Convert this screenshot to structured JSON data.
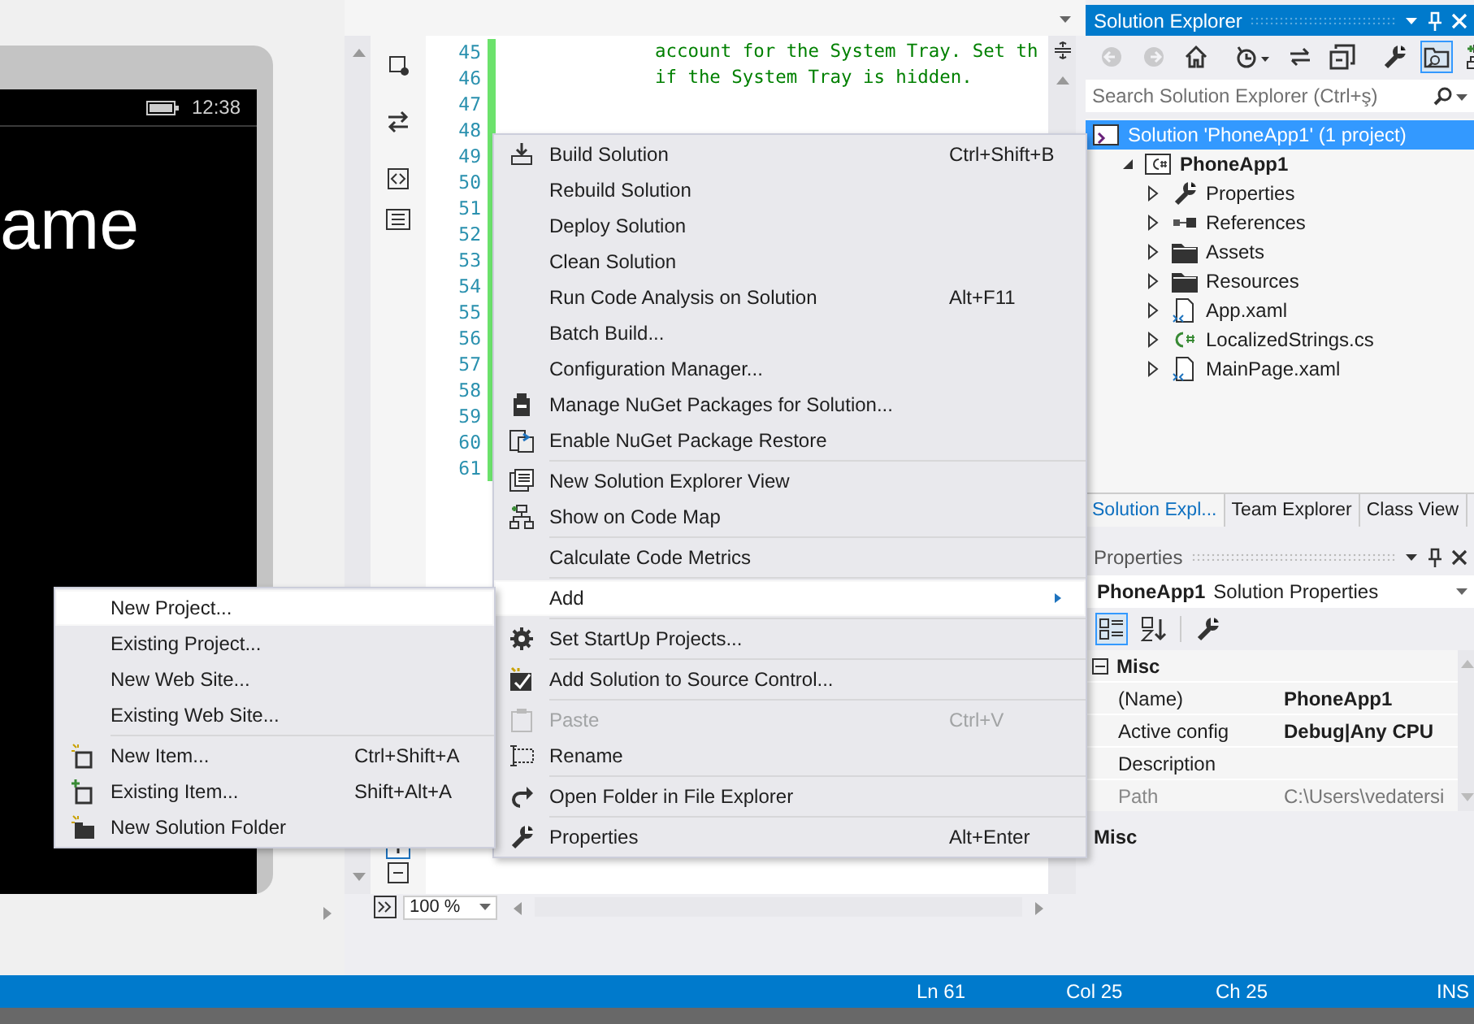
{
  "designer": {
    "time": "12:38",
    "title_fragment": "ame"
  },
  "editor": {
    "lines": [
      {
        "number": "45",
        "code": "account for the System Tray. Set th"
      },
      {
        "number": "46",
        "code": "if the System Tray is hidden."
      },
      {
        "number": "47"
      },
      {
        "number": "48"
      },
      {
        "number": "49"
      },
      {
        "number": "50"
      },
      {
        "number": "51"
      },
      {
        "number": "52"
      },
      {
        "number": "53"
      },
      {
        "number": "54"
      },
      {
        "number": "55"
      },
      {
        "number": "56"
      },
      {
        "number": "57"
      },
      {
        "number": "58"
      },
      {
        "number": "59"
      },
      {
        "number": "60"
      },
      {
        "number": "61"
      }
    ],
    "zoom": "100 %"
  },
  "context_menu": {
    "items": [
      {
        "kind": "item",
        "label": "Build Solution",
        "shortcut": "Ctrl+Shift+B",
        "selected": false,
        "disabled": false
      },
      {
        "kind": "item",
        "label": "Rebuild Solution",
        "selected": false,
        "disabled": false
      },
      {
        "kind": "item",
        "label": "Deploy Solution",
        "selected": false,
        "disabled": false
      },
      {
        "kind": "item",
        "label": "Clean Solution",
        "selected": false,
        "disabled": false
      },
      {
        "kind": "item",
        "label": "Run Code Analysis on Solution",
        "shortcut": "Alt+F11",
        "selected": false,
        "disabled": false
      },
      {
        "kind": "item",
        "label": "Batch Build...",
        "selected": false,
        "disabled": false
      },
      {
        "kind": "item",
        "label": "Configuration Manager...",
        "selected": false,
        "disabled": false
      },
      {
        "kind": "item",
        "label": "Manage NuGet Packages for Solution...",
        "selected": false,
        "disabled": false
      },
      {
        "kind": "item",
        "label": "Enable NuGet Package Restore",
        "selected": false,
        "disabled": false
      },
      {
        "kind": "separator"
      },
      {
        "kind": "item",
        "label": "New Solution Explorer View",
        "selected": false,
        "disabled": false
      },
      {
        "kind": "item",
        "label": "Show on Code Map",
        "selected": false,
        "disabled": false
      },
      {
        "kind": "separator"
      },
      {
        "kind": "item",
        "label": "Calculate Code Metrics",
        "selected": false,
        "disabled": false
      },
      {
        "kind": "separator"
      },
      {
        "kind": "submenu",
        "label": "Add",
        "selected": true,
        "disabled": false
      },
      {
        "kind": "separator"
      },
      {
        "kind": "item",
        "label": "Set StartUp Projects...",
        "selected": false,
        "disabled": false
      },
      {
        "kind": "separator"
      },
      {
        "kind": "item",
        "label": "Add Solution to Source Control...",
        "selected": false,
        "disabled": false
      },
      {
        "kind": "separator"
      },
      {
        "kind": "item",
        "label": "Paste",
        "shortcut": "Ctrl+V",
        "selected": false,
        "disabled": true
      },
      {
        "kind": "item",
        "label": "Rename",
        "selected": false,
        "disabled": false
      },
      {
        "kind": "separator"
      },
      {
        "kind": "item",
        "label": "Open Folder in File Explorer",
        "selected": false,
        "disabled": false
      },
      {
        "kind": "separator"
      },
      {
        "kind": "item",
        "label": "Properties",
        "shortcut": "Alt+Enter",
        "selected": false,
        "disabled": false
      }
    ]
  },
  "add_submenu": {
    "items": [
      {
        "kind": "item",
        "label": "New Project...",
        "selected": true,
        "disabled": false
      },
      {
        "kind": "item",
        "label": "Existing Project...",
        "selected": false,
        "disabled": false
      },
      {
        "kind": "item",
        "label": "New Web Site...",
        "selected": false,
        "disabled": false
      },
      {
        "kind": "item",
        "label": "Existing Web Site...",
        "selected": false,
        "disabled": false
      },
      {
        "kind": "separator"
      },
      {
        "kind": "item",
        "label": "New Item...",
        "shortcut": "Ctrl+Shift+A",
        "selected": false,
        "disabled": false
      },
      {
        "kind": "item",
        "label": "Existing Item...",
        "shortcut": "Shift+Alt+A",
        "selected": false,
        "disabled": false
      },
      {
        "kind": "item",
        "label": "New Solution Folder",
        "selected": false,
        "disabled": false
      }
    ]
  },
  "solution_explorer": {
    "title": "Solution Explorer",
    "toolbar": [
      {
        "kind": "back",
        "selected": false,
        "disabled": true
      },
      {
        "kind": "forward",
        "selected": false,
        "disabled": true
      },
      {
        "kind": "home",
        "selected": false,
        "disabled": false
      },
      {
        "kind": "separator"
      },
      {
        "kind": "history",
        "selected": false,
        "disabled": false
      },
      {
        "kind": "sync",
        "selected": false,
        "disabled": false
      },
      {
        "kind": "collapse",
        "selected": false,
        "disabled": false
      },
      {
        "kind": "separator"
      },
      {
        "kind": "properties",
        "selected": false,
        "disabled": false
      },
      {
        "kind": "preview",
        "selected": true,
        "disabled": false
      },
      {
        "kind": "codemap",
        "selected": false,
        "disabled": false
      }
    ],
    "search": {
      "placeholder": "Search Solution Explorer (Ctrl+ş)"
    },
    "tree": [
      {
        "kind": "solution",
        "label": "Solution 'PhoneApp1' (1 project)",
        "selected": true,
        "children": [
          {
            "kind": "project",
            "label": "PhoneApp1",
            "selected": false,
            "startup": true,
            "expanded": true,
            "children": [
              {
                "kind": "properties",
                "label": "Properties",
                "selected": false,
                "expanded": false
              },
              {
                "kind": "references",
                "label": "References",
                "selected": false,
                "expanded": false
              },
              {
                "kind": "folder",
                "label": "Assets",
                "selected": false,
                "expanded": false
              },
              {
                "kind": "folder",
                "label": "Resources",
                "selected": false,
                "expanded": false
              },
              {
                "kind": "xaml",
                "label": "App.xaml",
                "selected": false,
                "expanded": false
              },
              {
                "kind": "cs",
                "label": "LocalizedStrings.cs",
                "selected": false,
                "expanded": false
              },
              {
                "kind": "xaml",
                "label": "MainPage.xaml",
                "selected": false,
                "expanded": false
              }
            ]
          }
        ]
      }
    ],
    "tabs": [
      {
        "label": "Solution Expl...",
        "selected": true
      },
      {
        "label": "Team Explorer",
        "selected": false
      },
      {
        "label": "Class View",
        "selected": false
      }
    ]
  },
  "properties": {
    "title": "Properties",
    "object": {
      "name": "PhoneApp1",
      "type": "Solution Properties"
    },
    "toolbar": [
      {
        "kind": "categorized",
        "selected": true
      },
      {
        "kind": "alphabetical",
        "selected": false
      },
      {
        "kind": "separator"
      },
      {
        "kind": "pages",
        "selected": false
      }
    ],
    "category": {
      "label": "Misc",
      "expanded": true
    },
    "rows": [
      {
        "name": "(Name)",
        "value": "PhoneApp1",
        "modified": true,
        "disabled": false
      },
      {
        "name": "Active config",
        "value": "Debug|Any CPU",
        "modified": true,
        "disabled": false
      },
      {
        "name": "Description",
        "disabled": false
      },
      {
        "name": "Path",
        "value": "C:\\Users\\vedatersi",
        "modified": false,
        "disabled": true
      }
    ],
    "description_title": "Misc"
  },
  "status_bar": {
    "line": "Ln 61",
    "column": "Col 25",
    "char": "Ch 25",
    "mode": "INS"
  }
}
